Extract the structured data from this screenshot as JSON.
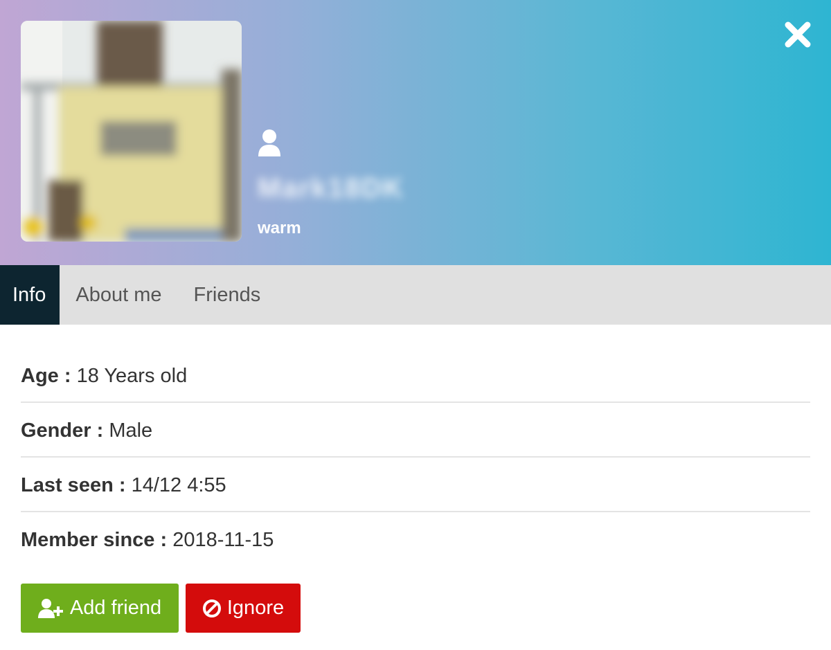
{
  "profile": {
    "username": "Mark18DK",
    "mood": "warm"
  },
  "header": {
    "close_icon": "close-icon",
    "user_icon": "user-icon",
    "gradient_colors": [
      "#c0a6d4",
      "#95afd8",
      "#5ab7d4",
      "#2eb5d2"
    ]
  },
  "tabs": [
    {
      "label": "Info",
      "active": true
    },
    {
      "label": "About me",
      "active": false
    },
    {
      "label": "Friends",
      "active": false
    }
  ],
  "info": [
    {
      "label": "Age :",
      "value": "18 Years old"
    },
    {
      "label": "Gender :",
      "value": "Male"
    },
    {
      "label": "Last seen :",
      "value": "14/12 4:55"
    },
    {
      "label": "Member since :",
      "value": "2018-11-15"
    }
  ],
  "actions": {
    "add_friend": {
      "label": "Add friend",
      "icon": "user-plus-icon",
      "color": "#6fae1c"
    },
    "ignore": {
      "label": "Ignore",
      "icon": "ban-icon",
      "color": "#d40c0c"
    }
  },
  "colors": {
    "active_tab": "#0d2530",
    "tab_bar": "#e0e0e0"
  }
}
